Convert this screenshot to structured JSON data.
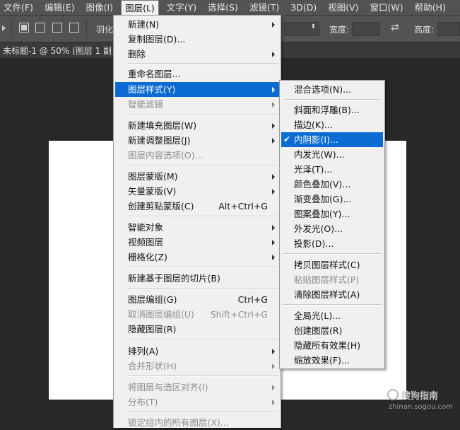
{
  "menubar": {
    "items": [
      {
        "label": "文件(F)"
      },
      {
        "label": "编辑(E)"
      },
      {
        "label": "图像(I)"
      },
      {
        "label": "图层(L)"
      },
      {
        "label": "文字(Y)"
      },
      {
        "label": "选择(S)"
      },
      {
        "label": "滤镜(T)"
      },
      {
        "label": "3D(D)"
      },
      {
        "label": "视图(V)"
      },
      {
        "label": "窗口(W)"
      },
      {
        "label": "帮助(H)"
      }
    ]
  },
  "options": {
    "feather": "羽化",
    "width": "宽度:",
    "height": "高度:"
  },
  "document": {
    "tab_title": "未标题-1 @ 50% (图层 1 副"
  },
  "layer_menu": {
    "items": [
      {
        "label": "新建(N)",
        "shortcut": "",
        "submenu": true,
        "disabled": false
      },
      {
        "label": "复制图层(D)...",
        "shortcut": "",
        "submenu": false,
        "disabled": false
      },
      {
        "label": "删除",
        "shortcut": "",
        "submenu": true,
        "disabled": false
      },
      {
        "label": "重命名图层...",
        "shortcut": "",
        "submenu": false,
        "disabled": false
      },
      {
        "label": "图层样式(Y)",
        "shortcut": "",
        "submenu": true,
        "disabled": false
      },
      {
        "label": "智能滤镜",
        "shortcut": "",
        "submenu": true,
        "disabled": true
      },
      {
        "label": "新建填充图层(W)",
        "shortcut": "",
        "submenu": true,
        "disabled": false
      },
      {
        "label": "新建调整图层(J)",
        "shortcut": "",
        "submenu": true,
        "disabled": false
      },
      {
        "label": "图层内容选项(O)...",
        "shortcut": "",
        "submenu": false,
        "disabled": true
      },
      {
        "label": "图层蒙版(M)",
        "shortcut": "",
        "submenu": true,
        "disabled": false
      },
      {
        "label": "矢量蒙版(V)",
        "shortcut": "",
        "submenu": true,
        "disabled": false
      },
      {
        "label": "创建剪贴蒙版(C)",
        "shortcut": "Alt+Ctrl+G",
        "submenu": false,
        "disabled": false
      },
      {
        "label": "智能对象",
        "shortcut": "",
        "submenu": true,
        "disabled": false
      },
      {
        "label": "视频图层",
        "shortcut": "",
        "submenu": true,
        "disabled": false
      },
      {
        "label": "栅格化(Z)",
        "shortcut": "",
        "submenu": true,
        "disabled": false
      },
      {
        "label": "新建基于图层的切片(B)",
        "shortcut": "",
        "submenu": false,
        "disabled": false
      },
      {
        "label": "图层编组(G)",
        "shortcut": "Ctrl+G",
        "submenu": false,
        "disabled": false
      },
      {
        "label": "取消图层编组(U)",
        "shortcut": "Shift+Ctrl+G",
        "submenu": false,
        "disabled": true
      },
      {
        "label": "隐藏图层(R)",
        "shortcut": "",
        "submenu": false,
        "disabled": false
      },
      {
        "label": "排列(A)",
        "shortcut": "",
        "submenu": true,
        "disabled": false
      },
      {
        "label": "合并形状(H)",
        "shortcut": "",
        "submenu": true,
        "disabled": true
      },
      {
        "label": "将图层与选区对齐(I)",
        "shortcut": "",
        "submenu": true,
        "disabled": true
      },
      {
        "label": "分布(T)",
        "shortcut": "",
        "submenu": true,
        "disabled": true
      },
      {
        "label": "锁定组内的所有图层(X)...",
        "shortcut": "",
        "submenu": false,
        "disabled": true
      }
    ]
  },
  "style_menu": {
    "items": [
      {
        "label": "混合选项(N)...",
        "disabled": false
      },
      {
        "label": "斜面和浮雕(B)...",
        "disabled": false
      },
      {
        "label": "描边(K)...",
        "disabled": false
      },
      {
        "label": "内阴影(I)...",
        "disabled": false
      },
      {
        "label": "内发光(W)...",
        "disabled": false
      },
      {
        "label": "光泽(T)...",
        "disabled": false
      },
      {
        "label": "颜色叠加(V)...",
        "disabled": false
      },
      {
        "label": "渐变叠加(G)...",
        "disabled": false
      },
      {
        "label": "图案叠加(Y)...",
        "disabled": false
      },
      {
        "label": "外发光(O)...",
        "disabled": false
      },
      {
        "label": "投影(D)...",
        "disabled": false
      },
      {
        "label": "拷贝图层样式(C)",
        "disabled": false
      },
      {
        "label": "粘贴图层样式(P)",
        "disabled": true
      },
      {
        "label": "清除图层样式(A)",
        "disabled": false
      },
      {
        "label": "全局光(L)...",
        "disabled": false
      },
      {
        "label": "创建图层(R)",
        "disabled": false
      },
      {
        "label": "隐藏所有效果(H)",
        "disabled": false
      },
      {
        "label": "缩放效果(F)...",
        "disabled": false
      }
    ],
    "checked_mark": "✔"
  },
  "watermark": {
    "name": "搜狗指南",
    "url": "zhinan.sogou.com"
  },
  "colors": {
    "highlight": "#0a6cd3",
    "menu_bg": "#f0f0f0",
    "ui_bg": "#535353"
  }
}
